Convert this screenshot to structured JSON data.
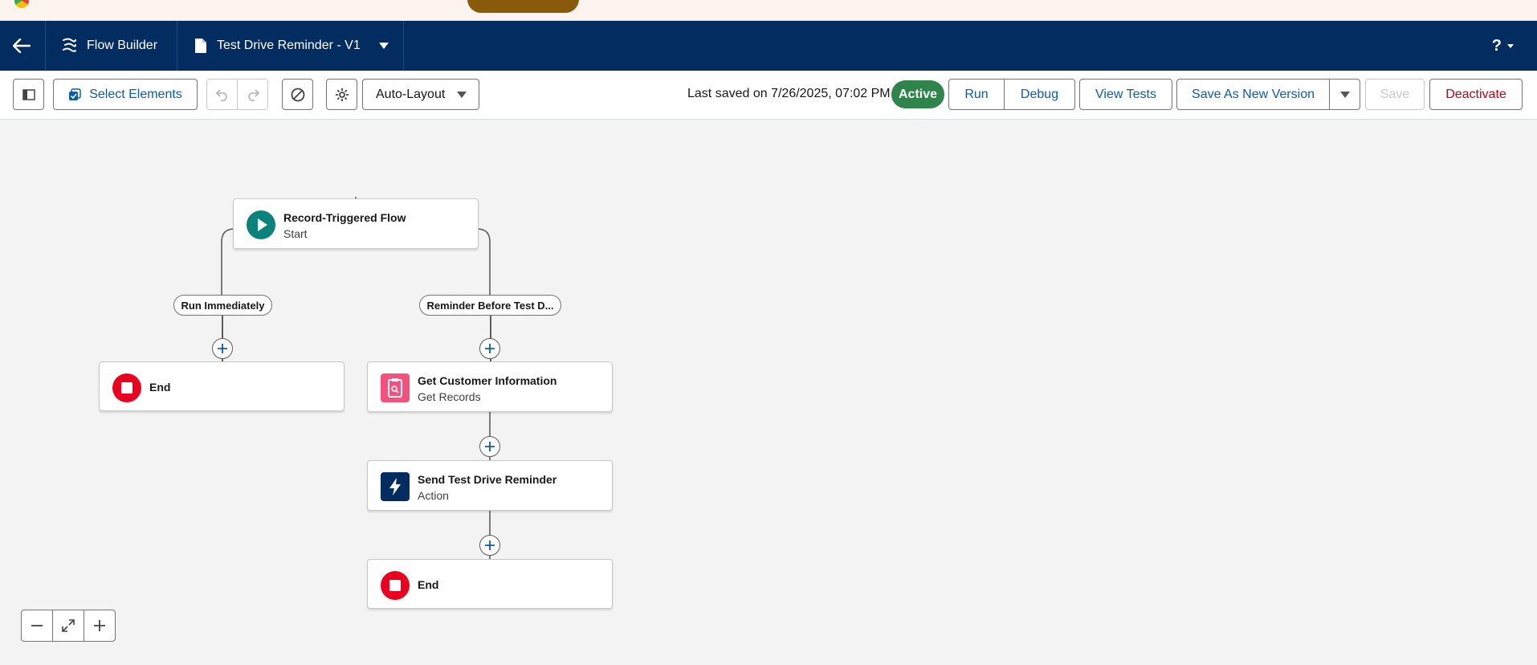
{
  "header": {
    "app_name": "Flow Builder",
    "file_name": "Test Drive Reminder - V1",
    "help_label": "?"
  },
  "toolbar": {
    "select_elements_label": "Select Elements",
    "layout_label": "Auto-Layout",
    "last_saved": "Last saved on 7/26/2025, 07:02 PM",
    "status_badge": "Active",
    "run_label": "Run",
    "debug_label": "Debug",
    "view_tests_label": "View Tests",
    "save_as_new_version_label": "Save As New Version",
    "save_label": "Save",
    "deactivate_label": "Deactivate"
  },
  "flow": {
    "start": {
      "title": "Record-Triggered Flow",
      "subtitle": "Start"
    },
    "paths": [
      {
        "label": "Run Immediately"
      },
      {
        "label": "Reminder Before Test D..."
      }
    ],
    "left_end": {
      "title": "End"
    },
    "get_records": {
      "title": "Get Customer Information",
      "subtitle": "Get Records"
    },
    "action": {
      "title": "Send Test Drive Reminder",
      "subtitle": "Action"
    },
    "right_end": {
      "title": "End"
    }
  },
  "colors": {
    "header_bg": "#032d60",
    "active_badge": "#2e844a",
    "start_icon": "#0b827c",
    "end_icon": "#ea001e",
    "get_records_icon": "#f4517f",
    "action_icon": "#032d60",
    "link_blue": "#0b5cab"
  }
}
